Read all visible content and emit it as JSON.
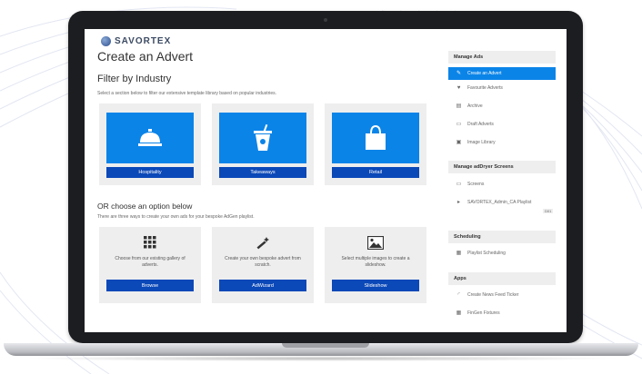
{
  "app": {
    "logo_text": "SAVORTEX",
    "page_title": "Create an Advert"
  },
  "filter": {
    "title": "Filter by Industry",
    "description": "Select a section below to filter our extensive template library based on popular industries.",
    "cards": [
      {
        "label": "Hospitality",
        "icon": "service-bell-icon"
      },
      {
        "label": "Takeaways",
        "icon": "takeaway-cup-icon"
      },
      {
        "label": "Retail",
        "icon": "shopping-bag-icon"
      }
    ]
  },
  "options": {
    "title": "OR choose an option below",
    "description": "There are three ways to create your own ads for your bespoke AdGen playlist.",
    "items": [
      {
        "text": "Choose from our existing gallery of adverts.",
        "button": "Browse",
        "icon": "grid-icon"
      },
      {
        "text": "Create your own bespoke advert from scratch.",
        "button": "AdWizard",
        "icon": "magic-wand-icon"
      },
      {
        "text": "Select multiple images to create a slideshow.",
        "button": "Slideshow",
        "icon": "image-icon"
      }
    ]
  },
  "sidebar": {
    "manage_ads": {
      "heading": "Manage Ads",
      "items": [
        {
          "label": "Create an Advert",
          "icon": "pencil-icon"
        },
        {
          "label": "Favourite Adverts",
          "icon": "heart-icon"
        },
        {
          "label": "Archive",
          "icon": "archive-icon"
        },
        {
          "label": "Draft Adverts",
          "icon": "draft-icon"
        },
        {
          "label": "Image Library",
          "icon": "image-library-icon"
        }
      ]
    },
    "screens": {
      "heading": "Manage adDryer Screens",
      "items": [
        {
          "label": "Screens",
          "icon": "monitor-icon"
        },
        {
          "label": "SAVORTEX_Admin_CA Playlist",
          "icon": "caret-right-icon"
        }
      ],
      "sub_label": "D01"
    },
    "scheduling": {
      "heading": "Scheduling",
      "items": [
        {
          "label": "Playlist Scheduling",
          "icon": "calendar-icon"
        }
      ]
    },
    "apps": {
      "heading": "Apps",
      "items": [
        {
          "label": "Create News Feed Ticker",
          "icon": "rss-icon"
        },
        {
          "label": "FinGen Fixtures",
          "icon": "calendar-icon"
        }
      ]
    }
  },
  "colors": {
    "accent_blue": "#0b84e8",
    "button_blue": "#0b48b8",
    "laptop_bezel": "#1c1d20"
  }
}
